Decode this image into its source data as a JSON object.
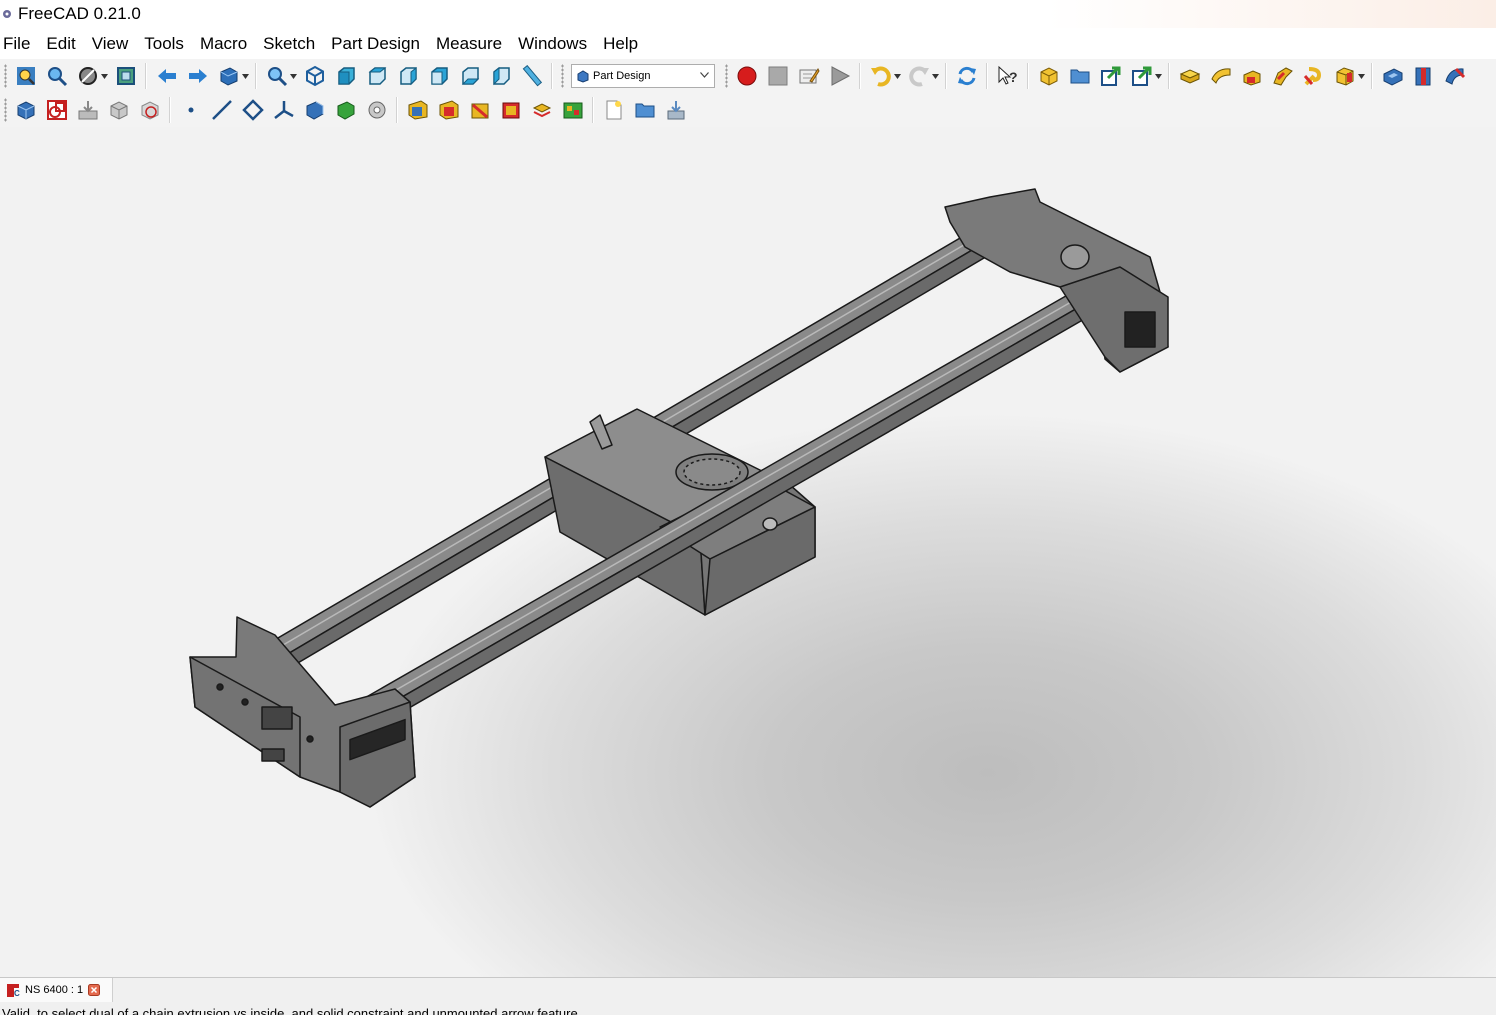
{
  "window": {
    "title": "FreeCAD 0.21.0"
  },
  "menu": [
    "File",
    "Edit",
    "View",
    "Tools",
    "Macro",
    "Sketch",
    "Part Design",
    "Measure",
    "Windows",
    "Help"
  ],
  "toolbar1": {
    "view_tools": [
      "fit-all-icon",
      "fit-selection-icon",
      "draw-style-icon",
      "bounding-box-icon",
      "back-arrow-icon",
      "forward-arrow-icon",
      "sync-view-icon",
      "zoom-icon",
      "isometric-view-icon",
      "front-view-icon",
      "top-view-icon",
      "right-view-icon",
      "rear-view-icon",
      "bottom-view-icon",
      "left-view-icon",
      "measure-ruler-icon"
    ],
    "workbench": "Part Design",
    "macro_tools": [
      "record-macro-icon",
      "stop-macro-icon",
      "edit-macro-icon",
      "run-macro-icon"
    ],
    "edit_tools": [
      "undo-icon",
      "redo-icon",
      "refresh-icon",
      "whats-this-icon"
    ],
    "part_tools": [
      "create-body-icon",
      "create-group-icon",
      "create-link-icon",
      "link-actions-icon",
      "pad-icon",
      "revolve-icon",
      "loft-icon",
      "pipe-icon",
      "helix-icon",
      "additive-box-icon",
      "pocket-icon",
      "hole-icon",
      "groove-icon"
    ]
  },
  "toolbar2": {
    "tools": [
      "create-body-2-icon",
      "create-sketch-icon",
      "import-icon",
      "box-icon",
      "validate-sketch-icon",
      "datum-point-icon",
      "datum-line-icon",
      "datum-plane-icon",
      "local-cs-icon",
      "shape-binder-icon",
      "subshape-binder-icon",
      "clone-icon",
      "fillet-icon",
      "chamfer-icon",
      "draft-icon",
      "thickness-icon",
      "mirror-icon",
      "linear-pattern-icon",
      "polar-pattern-icon",
      "new-document-icon",
      "open-file-icon",
      "save-file-icon"
    ]
  },
  "colors": {
    "model_fill": "#7c7c7c",
    "model_edge": "#1a1a1a",
    "record": "#d61c1c"
  },
  "document_tab": {
    "label": "NS 6400 : 1"
  },
  "status": {
    "text": "Valid, to select dual of a chain extrusion vs inside, and solid constraint and unmounted arrow feature"
  }
}
